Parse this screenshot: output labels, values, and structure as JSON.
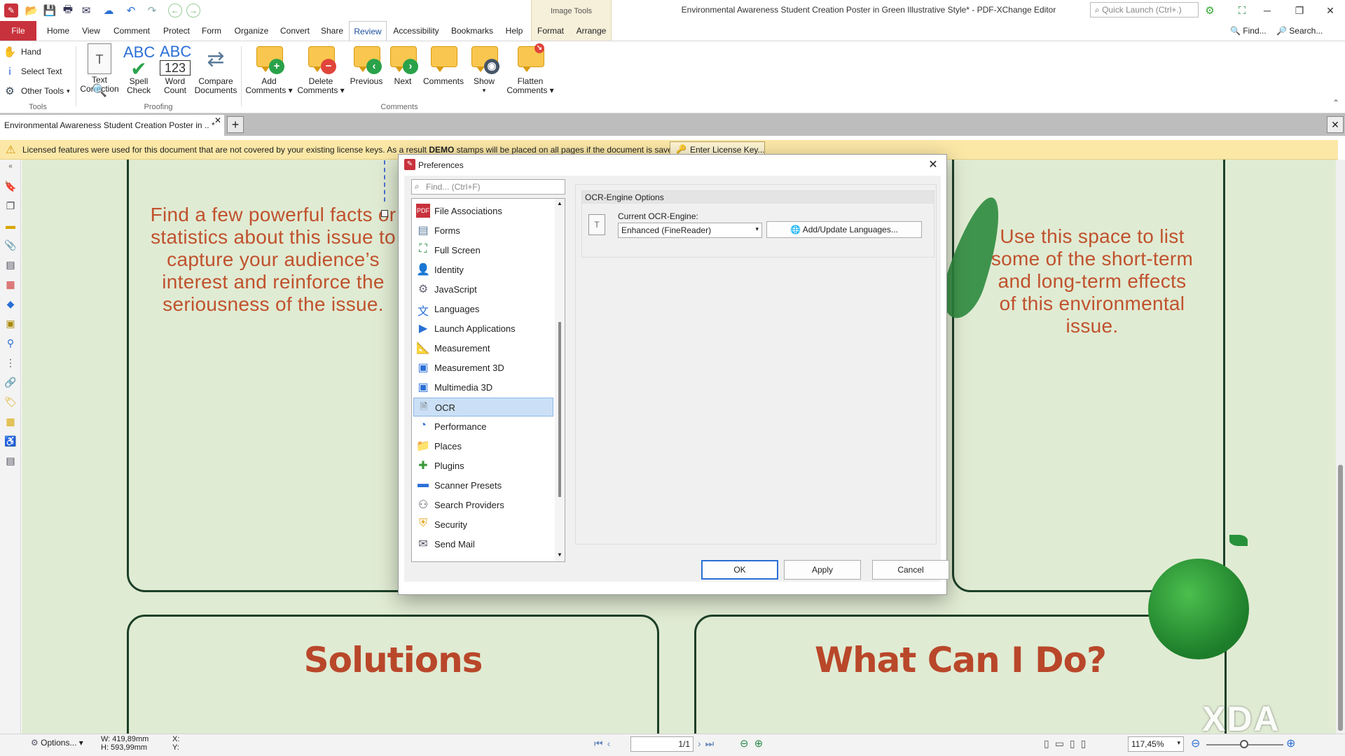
{
  "app": {
    "title": "Environmental Awareness Student Creation Poster in Green Illustrative Style* - PDF-XChange Editor",
    "quick_launch": "Quick Launch (Ctrl+.)",
    "image_tools": "Image Tools",
    "find": "Find...",
    "search": "Search..."
  },
  "menu": [
    "File",
    "Home",
    "View",
    "Comment",
    "Protect",
    "Form",
    "Organize",
    "Convert",
    "Share",
    "Review",
    "Accessibility",
    "Bookmarks",
    "Help",
    "Format",
    "Arrange"
  ],
  "ribbon": {
    "tools": {
      "hand": "Hand",
      "select_text": "Select Text",
      "other_tools": "Other Tools",
      "group": "Tools"
    },
    "proofing": {
      "text_correction": [
        "Text",
        "Correction"
      ],
      "spell_check": [
        "Spell",
        "Check"
      ],
      "word_count": [
        "Word",
        "Count"
      ],
      "compare": [
        "Compare",
        "Documents"
      ],
      "group": "Proofing"
    },
    "comments": {
      "add": [
        "Add",
        "Comments"
      ],
      "delete": [
        "Delete",
        "Comments"
      ],
      "previous": "Previous",
      "next": "Next",
      "comments": "Comments",
      "show": "Show",
      "flatten": [
        "Flatten",
        "Comments"
      ],
      "group": "Comments"
    }
  },
  "doc_tab": "Environmental Awareness Student Creation Poster in .. *",
  "warning": {
    "text_pre": "Licensed features were used for this document that are not covered by your existing license keys. As a result ",
    "text_bold": "DEMO",
    "text_post": " stamps will be placed on all pages if the document is saved.",
    "button": "Enter License Key..."
  },
  "poster": {
    "left_text": "Find a few powerful facts or statistics about this issue to capture your audience’s interest and reinforce the seriousness of the issue.",
    "right_text": "Use this space to list some of the short-term and long-term effects of this environmental issue.",
    "solutions": "Solutions",
    "what_can_i_do": "What Can I Do?"
  },
  "dialog": {
    "title": "Preferences",
    "search_placeholder": "Find... (Ctrl+F)",
    "items": [
      {
        "label": "File Associations",
        "icon": "pdf-icon"
      },
      {
        "label": "Forms",
        "icon": "form-icon"
      },
      {
        "label": "Full Screen",
        "icon": "fullscreen-icon"
      },
      {
        "label": "Identity",
        "icon": "person-icon"
      },
      {
        "label": "JavaScript",
        "icon": "script-icon"
      },
      {
        "label": "Languages",
        "icon": "language-icon"
      },
      {
        "label": "Launch Applications",
        "icon": "launch-icon"
      },
      {
        "label": "Measurement",
        "icon": "ruler-icon"
      },
      {
        "label": "Measurement 3D",
        "icon": "cube-icon"
      },
      {
        "label": "Multimedia 3D",
        "icon": "cube-icon"
      },
      {
        "label": "OCR",
        "icon": "ocr-icon",
        "selected": true
      },
      {
        "label": "Performance",
        "icon": "gauge-icon"
      },
      {
        "label": "Places",
        "icon": "folder-icon"
      },
      {
        "label": "Plugins",
        "icon": "puzzle-icon"
      },
      {
        "label": "Scanner Presets",
        "icon": "scanner-icon"
      },
      {
        "label": "Search Providers",
        "icon": "binoculars-icon"
      },
      {
        "label": "Security",
        "icon": "shield-icon"
      },
      {
        "label": "Send Mail",
        "icon": "mail-icon"
      }
    ],
    "group_title": "OCR-Engine Options",
    "engine_label": "Current OCR-Engine:",
    "engine_value": "Enhanced (FineReader)",
    "add_languages": "Add/Update Languages...",
    "ok": "OK",
    "apply": "Apply",
    "cancel": "Cancel"
  },
  "status": {
    "options": "Options...",
    "width": "W: 419,89mm",
    "height": "H: 593,99mm",
    "x": "X:",
    "y": "Y:",
    "page": "1/1",
    "zoom": "117,45%"
  },
  "watermark": "XDA"
}
